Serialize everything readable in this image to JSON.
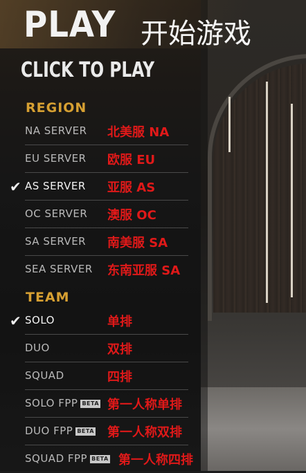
{
  "header": {
    "title": "PLAY",
    "title_cn": "开始游戏",
    "subtitle": "CLICK TO PLAY"
  },
  "region": {
    "heading": "REGION",
    "items": [
      {
        "label": "NA SERVER",
        "cn": "北美服 NA",
        "selected": false
      },
      {
        "label": "EU SERVER",
        "cn": "欧服 EU",
        "selected": false
      },
      {
        "label": "AS SERVER",
        "cn": "亚服 AS",
        "selected": true
      },
      {
        "label": "OC SERVER",
        "cn": "澳服 OC",
        "selected": false
      },
      {
        "label": "SA SERVER",
        "cn": "南美服 SA",
        "selected": false
      },
      {
        "label": "SEA SERVER",
        "cn": "东南亚服 SA",
        "selected": false
      }
    ]
  },
  "team": {
    "heading": "TEAM",
    "items": [
      {
        "label": "SOLO",
        "cn": "单排",
        "selected": true
      },
      {
        "label": "DUO",
        "cn": "双排",
        "selected": false
      },
      {
        "label": "SQUAD",
        "cn": "四排",
        "selected": false
      },
      {
        "label": "SOLO FPP",
        "badge": "BETA",
        "cn": "第一人称单排",
        "selected": false
      },
      {
        "label": "DUO FPP",
        "badge": "BETA",
        "cn": "第一人称双排",
        "selected": false
      },
      {
        "label": "SQUAD FPP",
        "badge": "BETA",
        "cn": "第一人称四排",
        "selected": false
      }
    ]
  },
  "check_glyph": "✔",
  "colors": {
    "section_heading": "#d7a032",
    "annotation_red": "#e01919",
    "selected_text": "#f4f4f4",
    "normal_text": "#b9b9b9"
  }
}
